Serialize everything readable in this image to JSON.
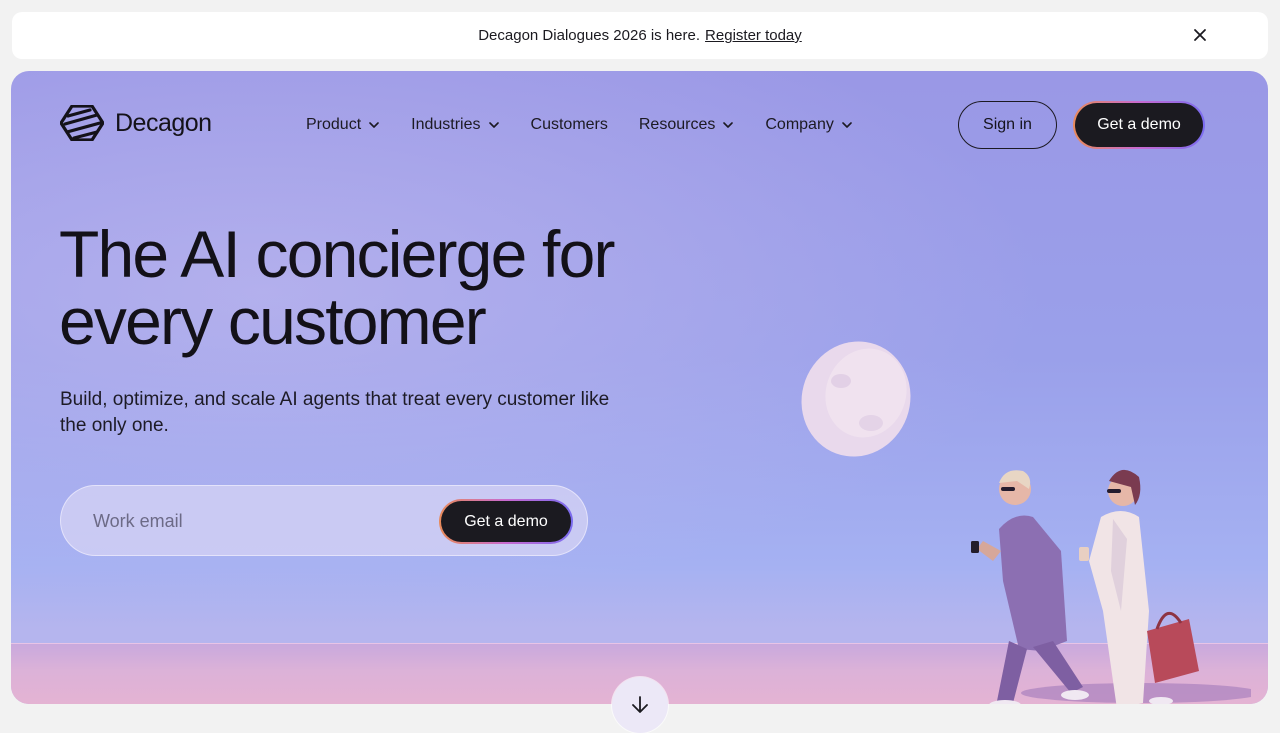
{
  "announcement": {
    "text": "Decagon Dialogues 2026 is here.",
    "link": "Register today",
    "close_icon": "close-icon"
  },
  "brand": {
    "name": "Decagon",
    "logo_icon": "decagon-logo-icon"
  },
  "nav": {
    "items": [
      {
        "label": "Product",
        "has_dropdown": true
      },
      {
        "label": "Industries",
        "has_dropdown": true
      },
      {
        "label": "Customers",
        "has_dropdown": false
      },
      {
        "label": "Resources",
        "has_dropdown": true
      },
      {
        "label": "Company",
        "has_dropdown": true
      }
    ],
    "sign_in": "Sign in",
    "get_demo": "Get a demo"
  },
  "hero": {
    "headline_line1": "The AI concierge for",
    "headline_line2": "every customer",
    "subtitle": "Build, optimize, and scale AI agents that treat every customer like the only one.",
    "email_placeholder": "Work email",
    "submit_label": "Get a demo",
    "scroll_icon": "arrow-down-icon"
  },
  "colors": {
    "sky": "#9a98e6",
    "ground": "#dcb2d8",
    "button_dark": "#1b1a20",
    "button_gradient": [
      "#e88a5a",
      "#c86ad0",
      "#7a6cf0"
    ]
  }
}
